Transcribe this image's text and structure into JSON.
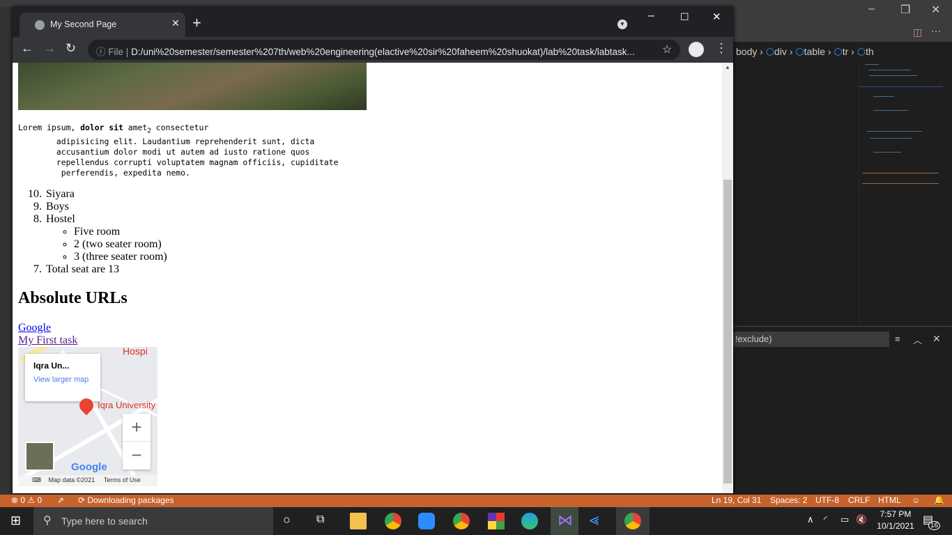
{
  "browser": {
    "tab_title": "My Second Page",
    "url_scheme_label": "File",
    "url": "D:/uni%20semester/semester%207th/web%20engineering(elactive%20sir%20faheem%20shuokat)/lab%20task/labtask..."
  },
  "editor": {
    "breadcrumbs": [
      "body",
      "div",
      "table",
      "tr",
      "th"
    ],
    "filter_placeholder": "t, !exclude)"
  },
  "page": {
    "pre_lines": [
      "Lorem ipsum, ",
      "dolor sit",
      " amet",
      "2",
      " consectetur",
      "        adipisicing elit. Laudantium reprehenderit sunt, dicta\n        accusantium dolor modi ut autem ad iusto ratione quos\n        repellendus corrupti voluptatem magnam officiis, cupiditate\n         perferendis, expedita nemo."
    ],
    "list": [
      {
        "num": "10.",
        "text": "Siyara"
      },
      {
        "num": "9.",
        "text": "Boys"
      },
      {
        "num": "8.",
        "text": "Hostel"
      },
      {
        "num": "7.",
        "text": "Total seat are 13"
      }
    ],
    "sublist": [
      "Five room",
      "2 (two seater room)",
      "3 (three seater room)"
    ],
    "heading": "Absolute URLs",
    "links": [
      "Google",
      "My First task"
    ],
    "map": {
      "place": "Iqra Un...",
      "view_larger": "View larger map",
      "label_university": "Iqra University",
      "label_hospital": "Hospi",
      "attribution": "Map data ©2021",
      "terms": "Terms of Use",
      "google": "Google",
      "zoom_in": "+",
      "zoom_out": "−"
    }
  },
  "status": {
    "errors": "0",
    "warnings": "0",
    "task": "Downloading packages",
    "position": "Ln 19, Col 31",
    "spaces": "Spaces: 2",
    "encoding": "UTF-8",
    "eol": "CRLF",
    "language": "HTML"
  },
  "taskbar": {
    "search_placeholder": "Type here to search",
    "time": "7:57 PM",
    "date": "10/1/2021",
    "notifications": "16"
  }
}
